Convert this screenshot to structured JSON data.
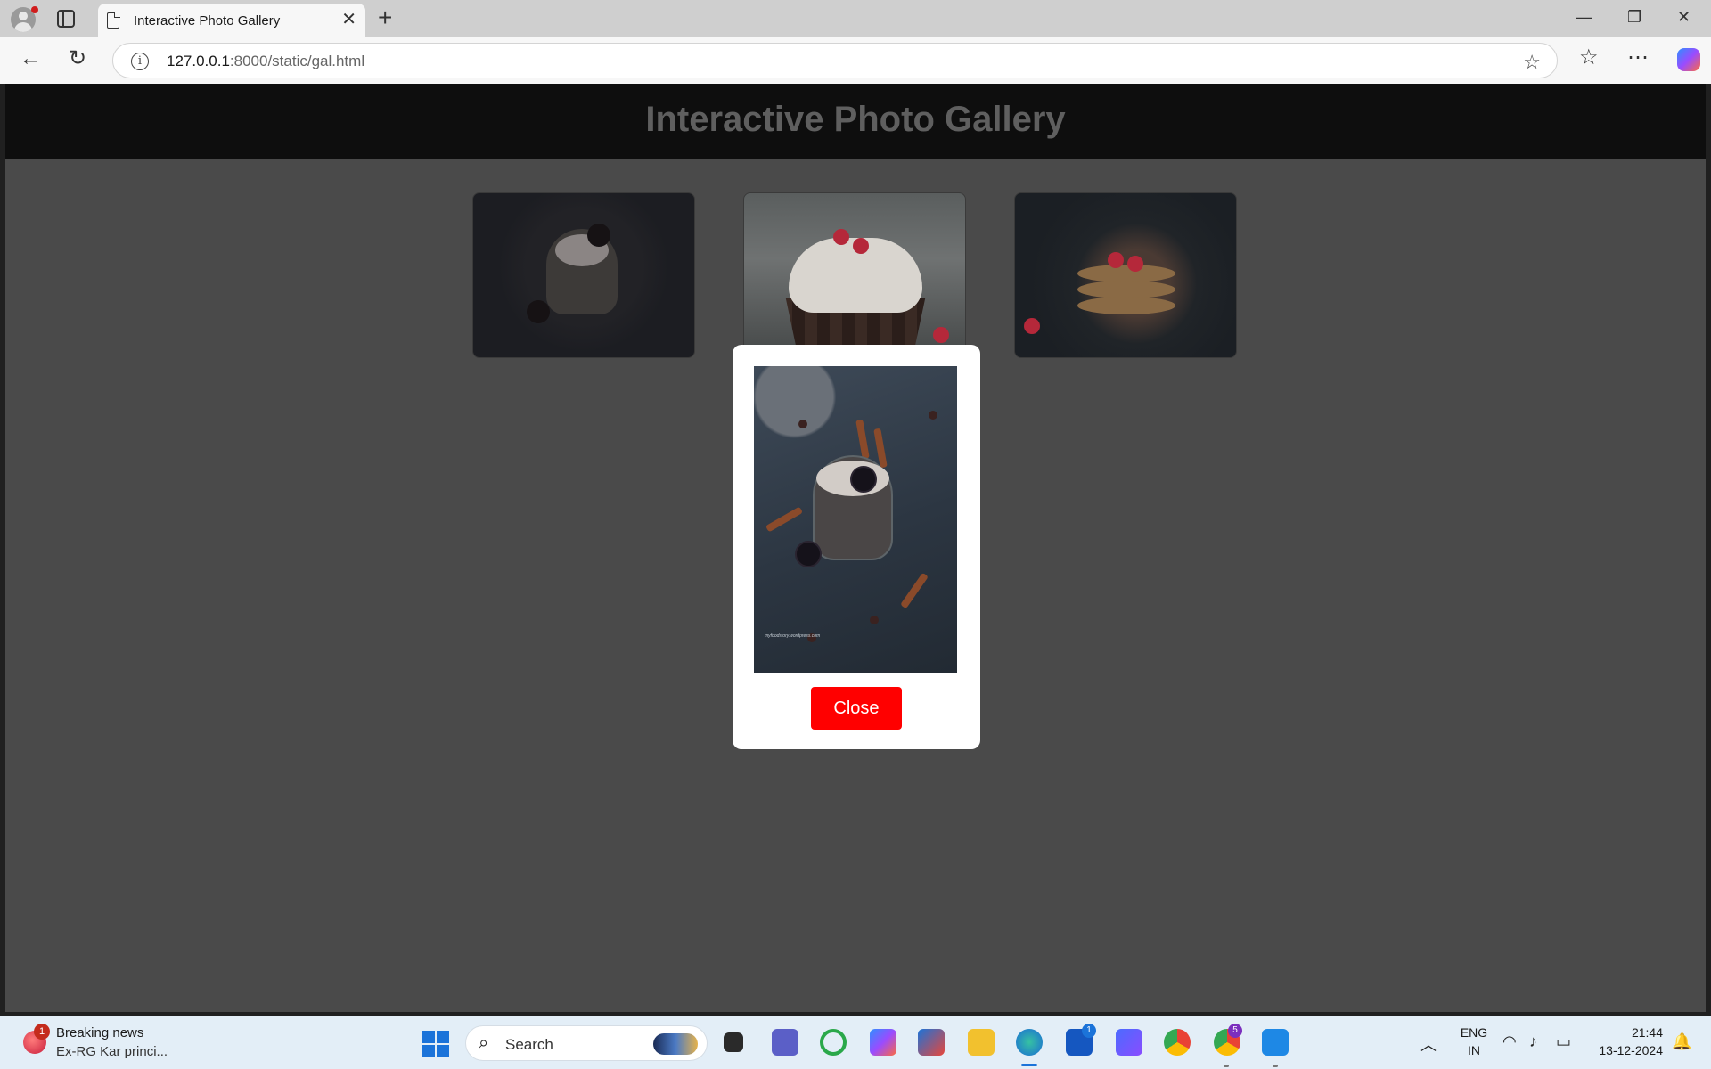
{
  "browser": {
    "tab_title": "Interactive Photo Gallery",
    "url_host": "127.0.0.1",
    "url_rest": ":8000/static/gal.html",
    "icons": {
      "profile": "profile-icon",
      "tab_actions": "tab-actions-icon",
      "back": "back-arrow-icon",
      "reload": "reload-icon",
      "info": "site-info-icon",
      "favorite": "star-icon",
      "favorites": "favorites-icon",
      "more": "more-icon",
      "copilot": "copilot-icon"
    }
  },
  "page": {
    "title": "Interactive Photo Gallery",
    "thumbnails": [
      {
        "subject": "hot chocolate with cookies"
      },
      {
        "subject": "raspberry cupcake"
      },
      {
        "subject": "pancakes with berries"
      }
    ]
  },
  "modal": {
    "close_label": "Close",
    "watermark": "myfoodstory.wordpress.com"
  },
  "taskbar": {
    "news_badge": "1",
    "news_title": "Breaking news",
    "news_subtitle": "Ex-RG Kar princi...",
    "search_label": "Search",
    "apps": [
      "file-explorer-icon",
      "teams-icon",
      "circle-app-icon",
      "copilot-icon",
      "store-icon",
      "folder-icon",
      "edge-icon",
      "l-app-icon",
      "a-app-icon",
      "chrome-icon",
      "chrome-profile-icon",
      "vscode-icon"
    ],
    "l_app_badge": "1",
    "chrome_badge": "5",
    "lang_line1": "ENG",
    "lang_line2": "IN",
    "time": "21:44",
    "date": "13-12-2024"
  },
  "colors": {
    "close_button": "#ff0000",
    "page_header": "#0e0e0e",
    "page_background": "#4a4a4a"
  }
}
